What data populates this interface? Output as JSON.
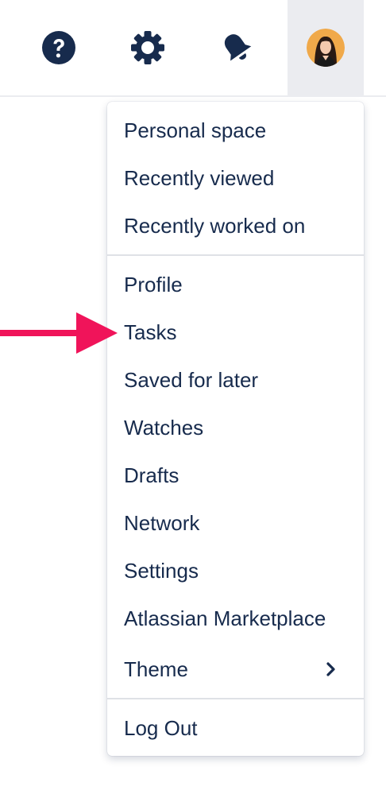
{
  "topbar": {
    "help_icon": "question-circle-icon",
    "settings_icon": "gear-icon",
    "notifications_icon": "megaphone-icon",
    "avatar_icon": "user-avatar"
  },
  "menu": {
    "section1": [
      "Personal space",
      "Recently viewed",
      "Recently worked on"
    ],
    "section2": [
      "Profile",
      "Tasks",
      "Saved for later",
      "Watches",
      "Drafts",
      "Network",
      "Settings",
      "Atlassian Marketplace",
      "Theme"
    ],
    "section3": [
      "Log Out"
    ],
    "theme_submenu_icon": "chevron-right-icon"
  },
  "annotation": {
    "arrow_color": "#f0145a",
    "arrow_target": "Tasks"
  },
  "colors": {
    "text": "#172b4d",
    "active_bg": "#ebecf0",
    "divider": "#dfe1e6"
  }
}
